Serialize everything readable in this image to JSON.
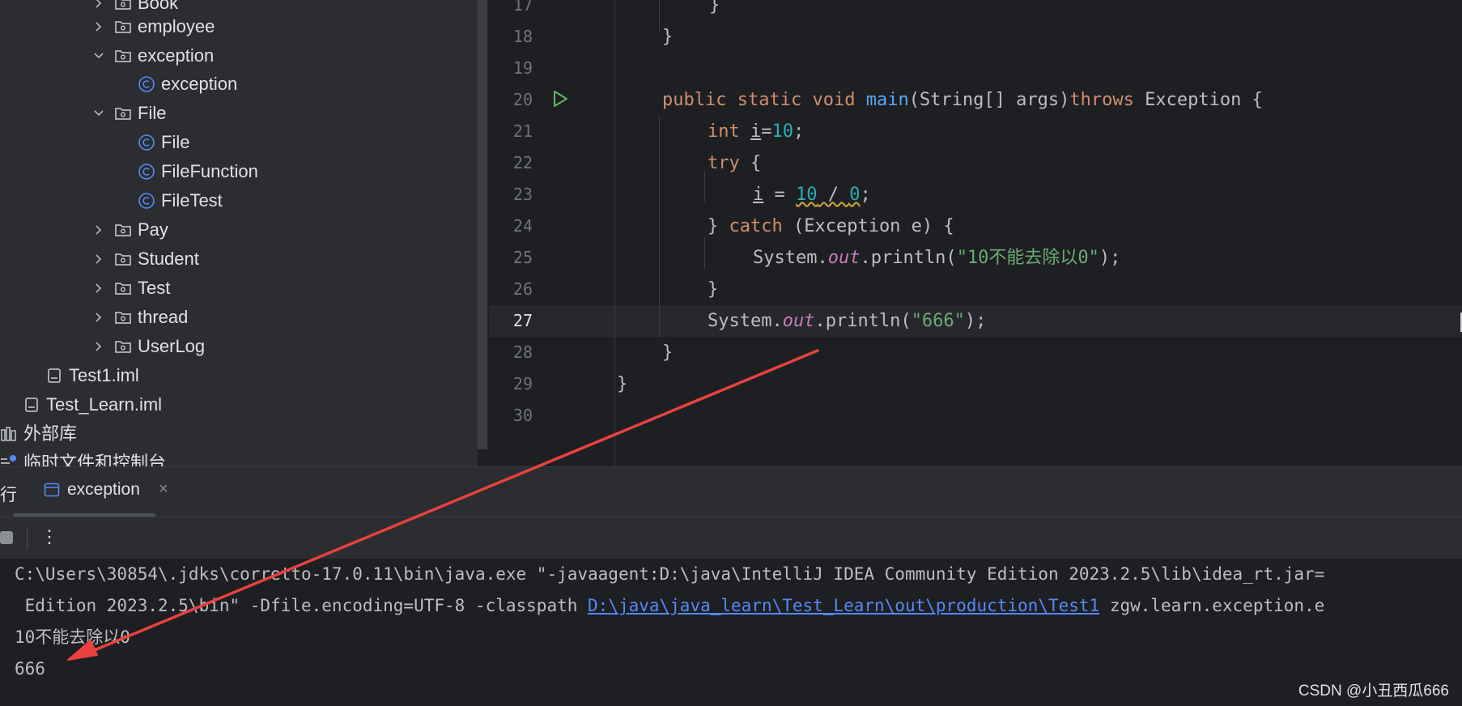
{
  "project_tree": {
    "items": [
      {
        "label": "Book",
        "kind": "folder",
        "state": "collapsed"
      },
      {
        "label": "employee",
        "kind": "folder",
        "state": "collapsed"
      },
      {
        "label": "exception",
        "kind": "folder",
        "state": "expanded"
      },
      {
        "label": "exception",
        "kind": "class"
      },
      {
        "label": "File",
        "kind": "folder",
        "state": "expanded"
      },
      {
        "label": "File",
        "kind": "class"
      },
      {
        "label": "FileFunction",
        "kind": "class"
      },
      {
        "label": "FileTest",
        "kind": "class"
      },
      {
        "label": "Pay",
        "kind": "folder",
        "state": "collapsed"
      },
      {
        "label": "Student",
        "kind": "folder",
        "state": "collapsed"
      },
      {
        "label": "Test",
        "kind": "folder",
        "state": "collapsed"
      },
      {
        "label": "thread",
        "kind": "folder",
        "state": "collapsed"
      },
      {
        "label": "UserLog",
        "kind": "folder",
        "state": "collapsed"
      },
      {
        "label": "Test1.iml",
        "kind": "file"
      },
      {
        "label": "Test_Learn.iml",
        "kind": "file"
      },
      {
        "label": "外部库",
        "kind": "library"
      },
      {
        "label": "临时文件和控制台",
        "kind": "scratches"
      }
    ]
  },
  "editor": {
    "current_line": "27",
    "line_numbers": [
      "17",
      "18",
      "19",
      "20",
      "21",
      "22",
      "23",
      "24",
      "25",
      "26",
      "27",
      "28",
      "29",
      "30"
    ],
    "tokens": {
      "l17_brace": "}",
      "l18_brace": "}",
      "l20_public": "public",
      "l20_static": "static",
      "l20_void": "void",
      "l20_main": "main",
      "l20_params": "(String[] args)",
      "l20_throws": "throws",
      "l20_rest": " Exception {",
      "l21_int": "int",
      "l21_i": "i",
      "l21_eq": "=",
      "l21_num": "10",
      "l21_semi": ";",
      "l22_try": "try",
      "l22_brace": " {",
      "l23_i": "i",
      "l23_eq": " = ",
      "l23_a": "10",
      "l23_div": " / ",
      "l23_b": "0",
      "l23_semi": ";",
      "l24_close": "} ",
      "l24_catch": "catch",
      "l24_rest": " (Exception e) {",
      "l25_system": "System.",
      "l25_out": "out",
      "l25_call": ".println(",
      "l25_str": "\"10不能去除以0\"",
      "l25_end": ");",
      "l26_brace": "}",
      "l27_system": "System.",
      "l27_out": "out",
      "l27_call": ".println(",
      "l27_str_a": "\"666",
      "l27_str_b": "\"",
      "l27_end": ");",
      "l28_brace": "}",
      "l29_brace": "}"
    }
  },
  "run_panel": {
    "partial_tab": "行",
    "tab_label": "exception",
    "close_glyph": "×",
    "more_glyph": "⋮",
    "console": {
      "line1": "C:\\Users\\30854\\.jdks\\corretto-17.0.11\\bin\\java.exe \"-javaagent:D:\\java\\IntelliJ IDEA Community Edition 2023.2.5\\lib\\idea_rt.jar=",
      "line2_prefix": " Edition 2023.2.5\\bin\" -Dfile.encoding=UTF-8 -classpath ",
      "line2_link": "D:\\java\\java_learn\\Test_Learn\\out\\production\\Test1",
      "line2_suffix": " zgw.learn.exception.e",
      "line3": "10不能去除以0",
      "line4": "666"
    }
  },
  "watermark": "CSDN @小丑西瓜666",
  "colors": {
    "keyword": "#cf8e6d",
    "function": "#56a8f5",
    "number": "#2aacb8",
    "string": "#6aab73",
    "static_field": "#c77dbb",
    "link": "#548af7",
    "annotation_arrow": "#e8413f"
  }
}
